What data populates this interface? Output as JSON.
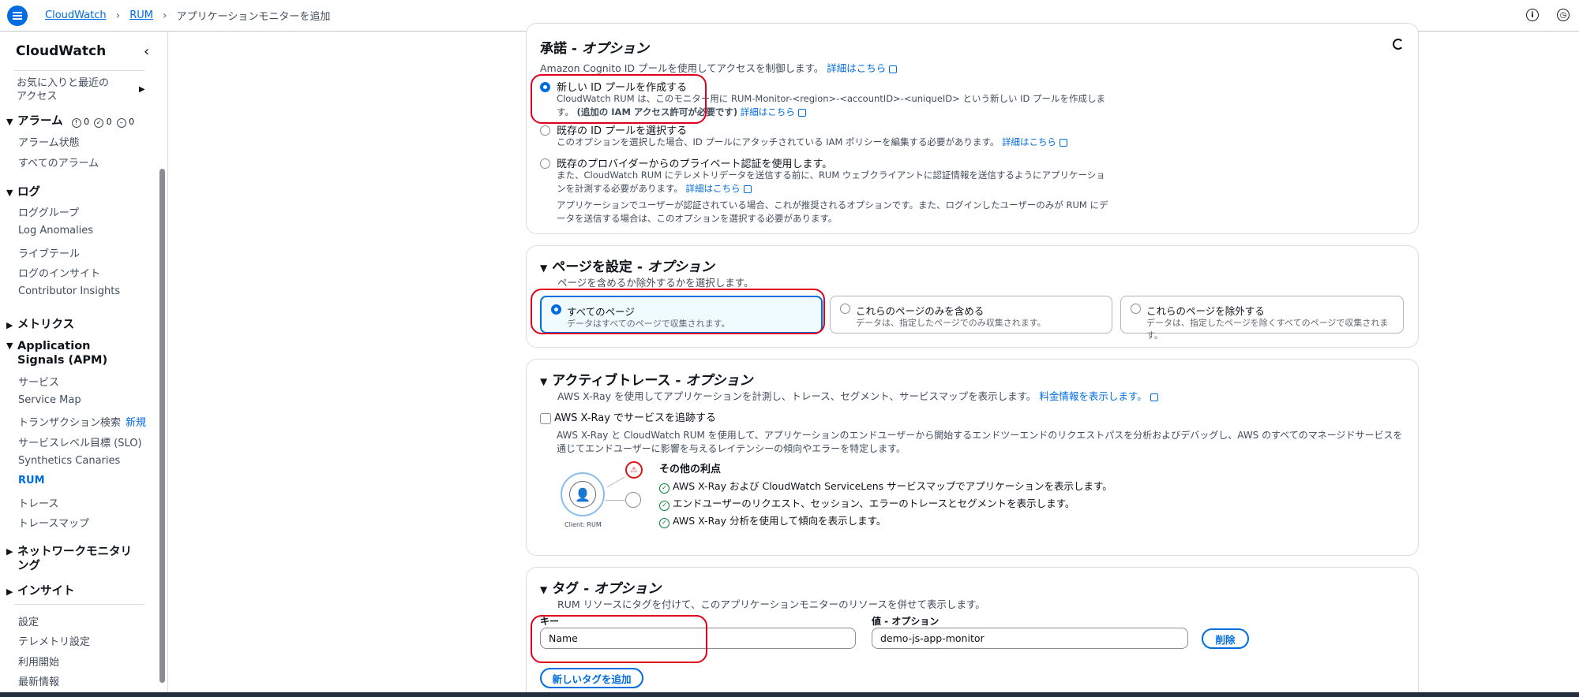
{
  "topbar": {
    "breadcrumb": [
      "CloudWatch",
      "RUM",
      "アプリケーションモニターを追加"
    ]
  },
  "sidebar": {
    "title": "CloudWatch",
    "favorites": "お気に入りと最近の\nアクセス",
    "alarms": {
      "label": "アラーム",
      "counts": [
        "0",
        "0",
        "0"
      ],
      "items": [
        "アラーム状態",
        "すべてのアラーム"
      ]
    },
    "logs": {
      "label": "ログ",
      "items": [
        "ロググループ",
        "Log Anomalies",
        "ライブテール",
        "ログのインサイト",
        "Contributor Insights"
      ]
    },
    "metrics": "メトリクス",
    "apm": {
      "label": "Application Signals (APM)",
      "items": [
        "サービス",
        "Service Map",
        "トランザクション検索",
        "サービスレベル目標 (SLO)",
        "Synthetics Canaries",
        "RUM",
        "トレース",
        "トレースマップ"
      ],
      "new_badge": "新規"
    },
    "network": "ネットワークモニタリング",
    "insights": "インサイト",
    "footer": [
      "設定",
      "テレメトリ設定",
      "利用開始",
      "最新情報"
    ]
  },
  "auth": {
    "title": "承諾",
    "title_suffix": "オプション",
    "desc": "Amazon Cognito ID プールを使用してアクセスを制御します。",
    "learn_more": "詳細はこちら",
    "options": [
      {
        "label": "新しい ID プールを作成する",
        "desc": "CloudWatch RUM は、このモニター用に RUM-Monitor-<region>-<accountID>-<uniqueID> という新しい ID プールを作成します。",
        "desc_bold": "(追加の IAM アクセス許可が必要です)",
        "link": "詳細はこちら"
      },
      {
        "label": "既存の ID プールを選択する",
        "desc": "このオプションを選択した場合、ID プールにアタッチされている IAM ポリシーを編集する必要があります。",
        "link": "詳細はこちら"
      },
      {
        "label": "既存のプロバイダーからのプライベート認証を使用します。",
        "desc": "また、CloudWatch RUM にテレメトリデータを送信する前に、RUM ウェブクライアントに認証情報を送信するようにアプリケーションを計測する必要があります。",
        "link": "詳細はこちら",
        "note": "アプリケーションでユーザーが認証されている場合、これが推奨されるオプションです。また、ログインしたユーザーのみが RUM にデータを送信する場合は、このオプションを選択する必要があります。"
      }
    ]
  },
  "pages": {
    "title": "ページを設定",
    "title_suffix": "オプション",
    "desc": "ページを含めるか除外するかを選択します。",
    "tiles": [
      {
        "label": "すべてのページ",
        "desc": "データはすべてのページで収集されます。"
      },
      {
        "label": "これらのページのみを含める",
        "desc": "データは、指定したページでのみ収集されます。"
      },
      {
        "label": "これらのページを除外する",
        "desc": "データは、指定したページを除くすべてのページで収集されます。"
      }
    ]
  },
  "trace": {
    "title": "アクティブトレース",
    "title_suffix": "オプション",
    "desc": "AWS X-Ray を使用してアプリケーションを計測し、トレース、セグメント、サービスマップを表示します。",
    "pricing": "料金情報を表示します。",
    "checkbox": "AWS X-Ray でサービスを追跡する",
    "body": "AWS X-Ray と CloudWatch RUM を使用して、アプリケーションのエンドユーザーから開始するエンドツーエンドのリクエストパスを分析およびデバッグし、AWS のすべてのマネージドサービスを通じてエンドユーザーに影響を与えるレイテンシーの傾向やエラーを特定します。",
    "benefits_title": "その他の利点",
    "benefits": [
      "AWS X-Ray および CloudWatch ServiceLens サービスマップでアプリケーションを表示します。",
      "エンドユーザーのリクエスト、セッション、エラーのトレースとセグメントを表示します。",
      "AWS X-Ray 分析を使用して傾向を表示します。"
    ],
    "diagram_label": "Client: RUM"
  },
  "tags": {
    "title": "タグ",
    "title_suffix": "オプション",
    "desc": "RUM リソースにタグを付けて、このアプリケーションモニターのリソースを併せて表示します。",
    "key_label": "キー",
    "value_label": "値 - オプション",
    "key_value": "Name",
    "value_value": "demo-js-app-monitor",
    "remove": "削除",
    "add": "新しいタグを追加"
  }
}
